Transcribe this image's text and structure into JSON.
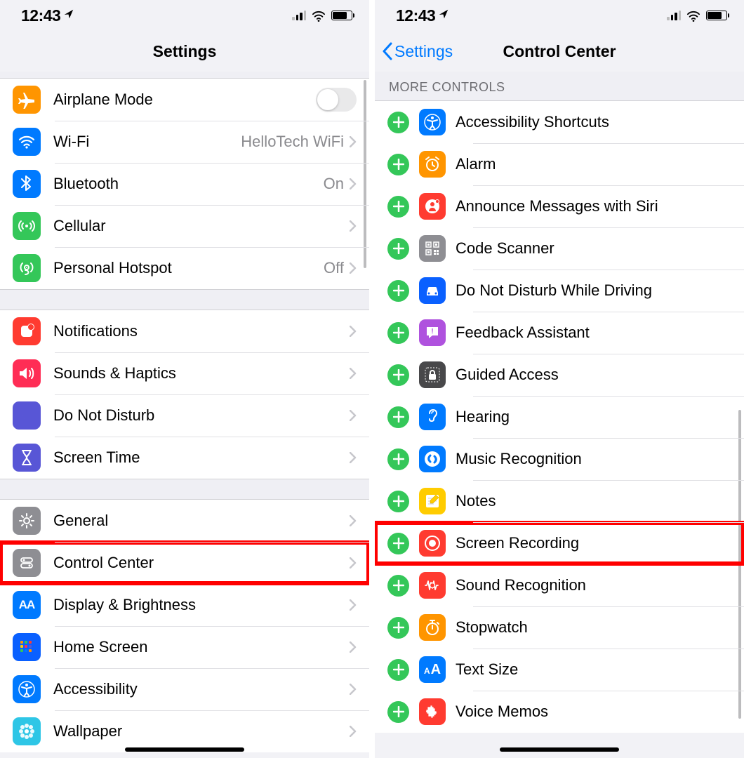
{
  "status": {
    "time": "12:43"
  },
  "left": {
    "title": "Settings",
    "rows1": [
      {
        "icon": "airplane",
        "color": "c-orange",
        "label": "Airplane Mode",
        "toggle": true
      },
      {
        "icon": "wifi",
        "color": "c-blue",
        "label": "Wi-Fi",
        "value": "HelloTech WiFi",
        "chev": true
      },
      {
        "icon": "bt",
        "color": "c-blue",
        "label": "Bluetooth",
        "value": "On",
        "chev": true
      },
      {
        "icon": "cell",
        "color": "c-green",
        "label": "Cellular",
        "chev": true
      },
      {
        "icon": "hotspot",
        "color": "c-green",
        "label": "Personal Hotspot",
        "value": "Off",
        "chev": true
      }
    ],
    "rows2": [
      {
        "icon": "notif",
        "color": "c-red",
        "label": "Notifications",
        "chev": true
      },
      {
        "icon": "sound",
        "color": "c-pink",
        "label": "Sounds & Haptics",
        "chev": true
      },
      {
        "icon": "dnd",
        "color": "c-purple",
        "label": "Do Not Disturb",
        "chev": true
      },
      {
        "icon": "hourglass",
        "color": "c-purple",
        "label": "Screen Time",
        "chev": true
      }
    ],
    "rows3": [
      {
        "icon": "gear",
        "color": "c-gray",
        "label": "General",
        "chev": true
      },
      {
        "icon": "cc",
        "color": "c-gray",
        "label": "Control Center",
        "chev": true,
        "hl": true
      },
      {
        "icon": "aa",
        "color": "c-blue",
        "label": "Display & Brightness",
        "chev": true
      },
      {
        "icon": "grid",
        "color": "c-bluedeep",
        "label": "Home Screen",
        "chev": true
      },
      {
        "icon": "acc",
        "color": "c-blue",
        "label": "Accessibility",
        "chev": true
      },
      {
        "icon": "flower",
        "color": "#2ec6e6",
        "label": "Wallpaper",
        "chev": true,
        "custom": true
      }
    ]
  },
  "right": {
    "back": "Settings",
    "title": "Control Center",
    "section": "MORE CONTROLS",
    "items": [
      {
        "icon": "acc",
        "color": "c-blue",
        "label": "Accessibility Shortcuts"
      },
      {
        "icon": "alarm",
        "color": "c-orange",
        "label": "Alarm"
      },
      {
        "icon": "announce",
        "color": "c-red",
        "label": "Announce Messages with Siri"
      },
      {
        "icon": "qr",
        "color": "c-gray",
        "label": "Code Scanner"
      },
      {
        "icon": "car",
        "color": "c-bluedeep",
        "label": "Do Not Disturb While Driving"
      },
      {
        "icon": "feedback",
        "color": "c-purple2",
        "label": "Feedback Assistant"
      },
      {
        "icon": "lock",
        "color": "c-dgray",
        "label": "Guided Access"
      },
      {
        "icon": "ear",
        "color": "c-blue",
        "label": "Hearing"
      },
      {
        "icon": "shazam",
        "color": "c-blue",
        "label": "Music Recognition"
      },
      {
        "icon": "notes",
        "color": "c-yellow",
        "label": "Notes"
      },
      {
        "icon": "record",
        "color": "c-red",
        "label": "Screen Recording",
        "hl": true
      },
      {
        "icon": "waves",
        "color": "c-red",
        "label": "Sound Recognition"
      },
      {
        "icon": "stopwatch",
        "color": "c-orange",
        "label": "Stopwatch"
      },
      {
        "icon": "textsize",
        "color": "c-blue",
        "label": "Text Size"
      },
      {
        "icon": "voice",
        "color": "c-red",
        "label": "Voice Memos"
      }
    ]
  }
}
